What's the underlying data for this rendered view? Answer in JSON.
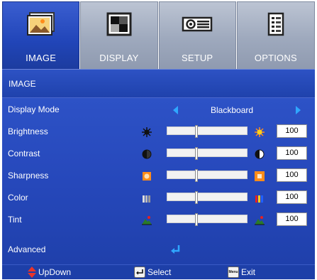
{
  "tabs": [
    {
      "label": "IMAGE",
      "icon": "image-icon",
      "active": true
    },
    {
      "label": "DISPLAY",
      "icon": "display-icon",
      "active": false
    },
    {
      "label": "SETUP",
      "icon": "projector-icon",
      "active": false
    },
    {
      "label": "OPTIONS",
      "icon": "options-icon",
      "active": false
    }
  ],
  "section": {
    "title": "IMAGE"
  },
  "display_mode": {
    "label": "Display Mode",
    "value": "Blackboard"
  },
  "adjustments": [
    {
      "label": "Brightness",
      "value": "100",
      "level": 0.36
    },
    {
      "label": "Contrast",
      "value": "100",
      "level": 0.36
    },
    {
      "label": "Sharpness",
      "value": "100",
      "level": 0.36
    },
    {
      "label": "Color",
      "value": "100",
      "level": 0.36
    },
    {
      "label": "Tint",
      "value": "100",
      "level": 0.36
    }
  ],
  "advanced": {
    "label": "Advanced"
  },
  "footer": {
    "updown": "UpDown",
    "select": "Select",
    "exit": "Exit",
    "menu_key": "Menu"
  },
  "colors": {
    "active_tab": "#2145b8",
    "inactive_tab": "#9ea9bd",
    "panel": "#2648bb",
    "arrow": "#2fa7ff",
    "enter": "#2fa7ff",
    "updown_arrow": "#e8342a"
  }
}
